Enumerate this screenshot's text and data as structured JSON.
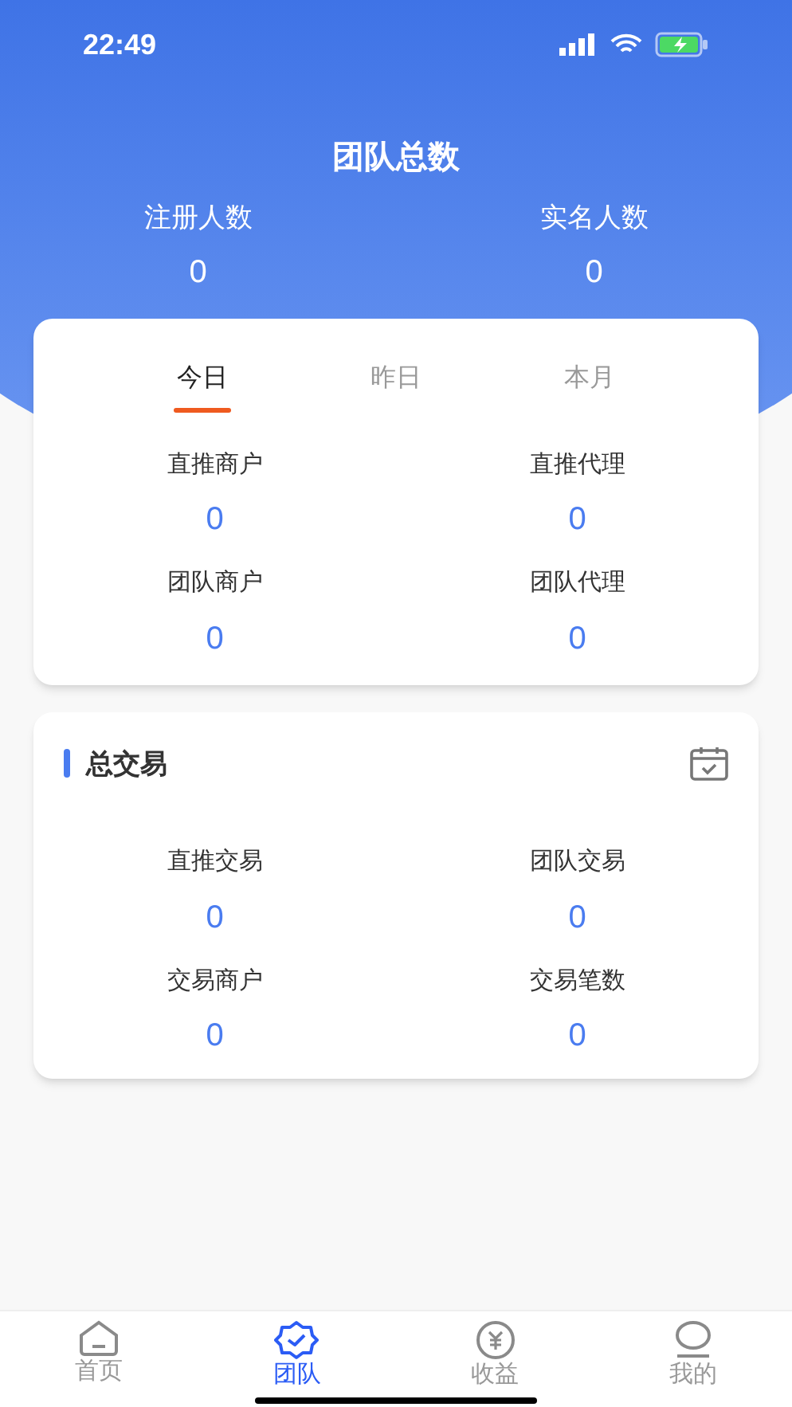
{
  "status_bar": {
    "time": "22:49"
  },
  "header": {
    "title": "团队总数",
    "stats": [
      {
        "label": "注册人数",
        "value": "0"
      },
      {
        "label": "实名人数",
        "value": "0"
      }
    ]
  },
  "period_card": {
    "tabs": [
      {
        "label": "今日",
        "selected": true
      },
      {
        "label": "昨日",
        "selected": false
      },
      {
        "label": "本月",
        "selected": false
      }
    ],
    "stats": [
      {
        "label": "直推商户",
        "value": "0"
      },
      {
        "label": "直推代理",
        "value": "0"
      },
      {
        "label": "团队商户",
        "value": "0"
      },
      {
        "label": "团队代理",
        "value": "0"
      }
    ]
  },
  "trade_card": {
    "title": "总交易",
    "stats": [
      {
        "label": "直推交易",
        "value": "0"
      },
      {
        "label": "团队交易",
        "value": "0"
      },
      {
        "label": "交易商户",
        "value": "0"
      },
      {
        "label": "交易笔数",
        "value": "0"
      }
    ]
  },
  "tab_bar": [
    {
      "label": "首页",
      "kind": "home",
      "selected": false
    },
    {
      "label": "团队",
      "kind": "team",
      "selected": true
    },
    {
      "label": "收益",
      "kind": "income",
      "selected": false
    },
    {
      "label": "我的",
      "kind": "me",
      "selected": false
    }
  ]
}
